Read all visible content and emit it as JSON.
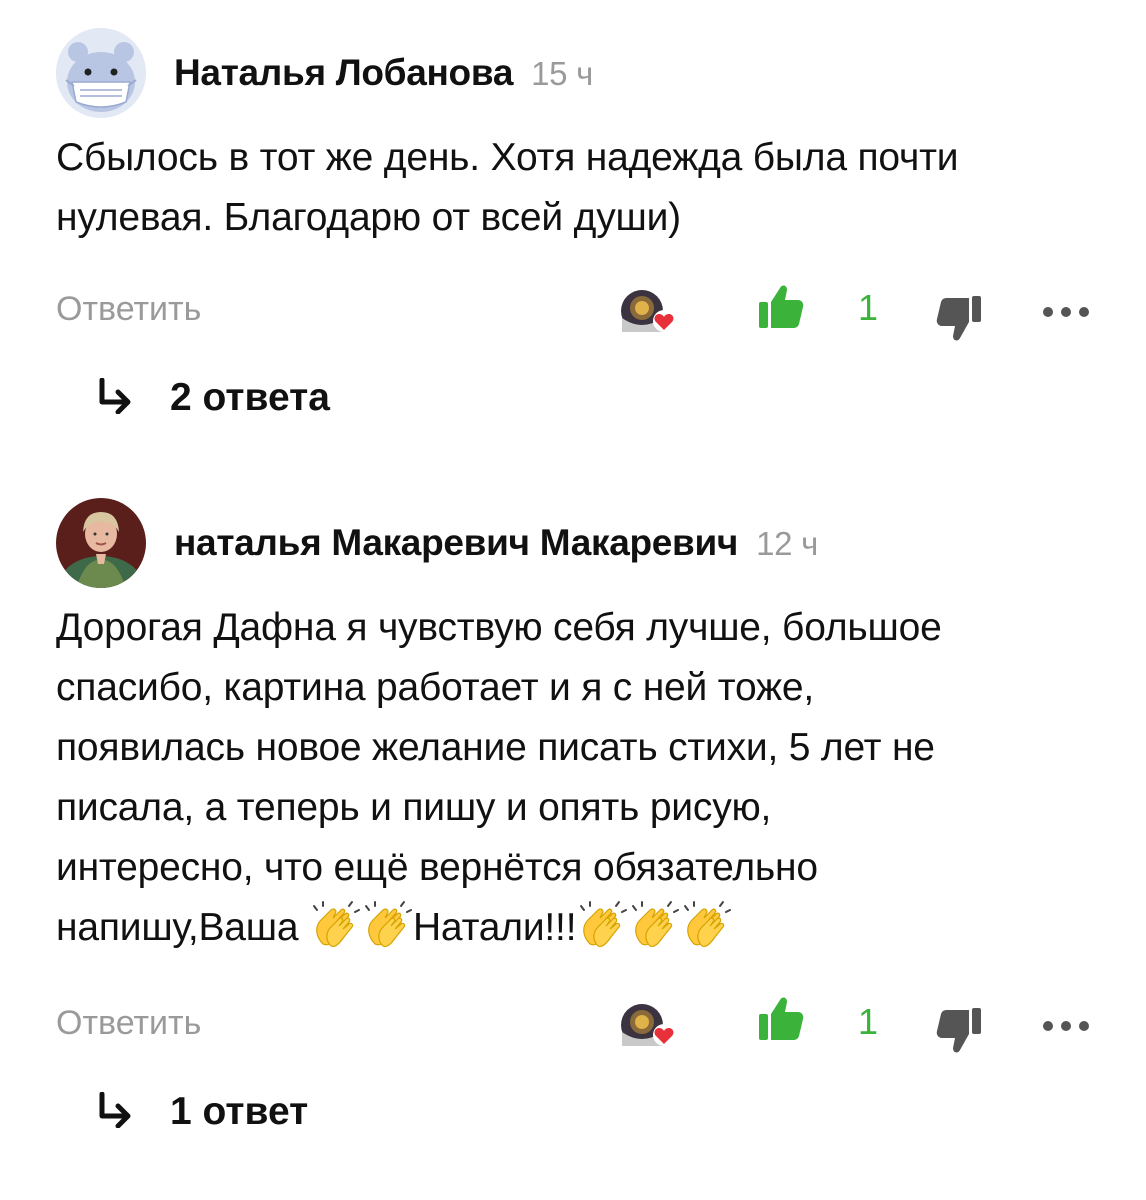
{
  "comments": [
    {
      "author": "Наталья Лобанова",
      "time": "15 ч",
      "text_lines": [
        "Сбылось в тот же день. Хотя надежда была почти",
        "нулевая. Благодарю от всей души)"
      ],
      "reply_label": "Ответить",
      "likes": "1",
      "replies": "2 ответа",
      "avatar_icon": "bear-in-mask-avatar"
    },
    {
      "author": "наталья Макаревич Макаревич",
      "time": "12 ч",
      "text_lines": [
        "Дорогая Дафна я чувствую себя лучше, большое",
        "спасибо, картина работает и я с ней тоже,",
        "появилась новое желание писать стихи, 5 лет не",
        "писала, а теперь и пишу и опять рисую,",
        "интересно, что ещё вернётся обязательно"
      ],
      "last_line_a": "напишу,Ваша ",
      "last_line_b": "Натали!!!",
      "reply_label": "Ответить",
      "likes": "1",
      "replies": "1 ответ",
      "avatar_icon": "woman-portrait-avatar"
    }
  ],
  "colors": {
    "like_green": "#3bb33b",
    "muted_gray": "#9a9a9a",
    "text_dark": "#111111",
    "dislike_gray": "#555555"
  },
  "icons": [
    "reacted-avatar-heart-icon",
    "thumbs-up-icon",
    "thumbs-down-icon",
    "more-dots-icon",
    "reply-arrow-icon",
    "clapping-hands-icon"
  ]
}
